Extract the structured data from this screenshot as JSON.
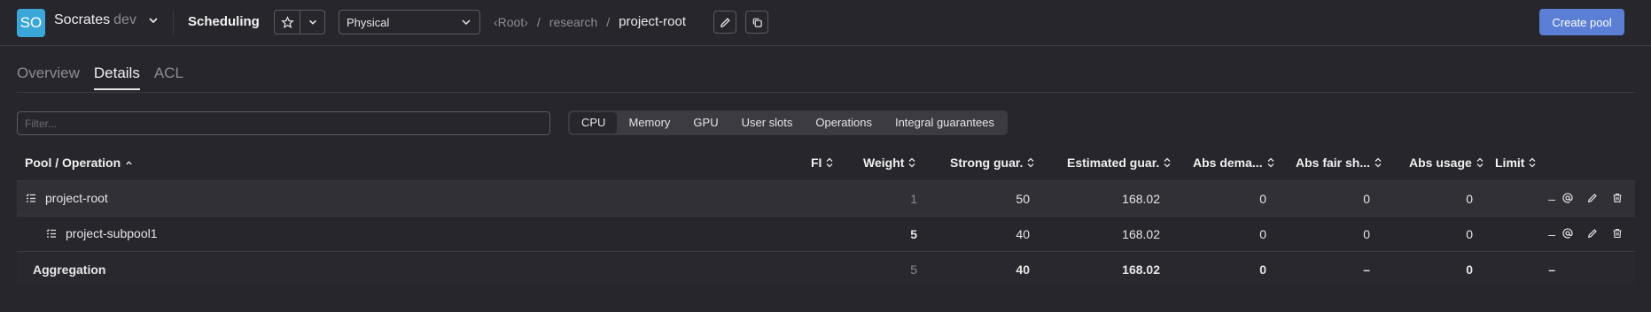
{
  "header": {
    "logo": "SO",
    "cluster_name": "Socrates",
    "cluster_env": "dev",
    "page_title": "Scheduling",
    "tree": "Physical",
    "breadcrumb": [
      "‹Root›",
      "/",
      "research",
      "/",
      "project-root"
    ],
    "create_label": "Create pool"
  },
  "tabs": [
    {
      "label": "Overview",
      "active": false
    },
    {
      "label": "Details",
      "active": true
    },
    {
      "label": "ACL",
      "active": false
    }
  ],
  "toolbar": {
    "filter_placeholder": "Filter...",
    "resources": [
      "CPU",
      "Memory",
      "GPU",
      "User slots",
      "Operations",
      "Integral guarantees"
    ],
    "active_resource": "CPU"
  },
  "table": {
    "columns": [
      "Pool / Operation",
      "FI",
      "Weight",
      "Strong guar.",
      "Estimated guar.",
      "Abs dema...",
      "Abs fair sh...",
      "Abs usage",
      "Limit"
    ],
    "rows": [
      {
        "name": "project-root",
        "weight": "1",
        "strong": "50",
        "estimated": "168.02",
        "abs_demand": "0",
        "abs_fair": "0",
        "abs_usage": "0",
        "limit": "–"
      },
      {
        "name": "project-subpool1",
        "weight": "5",
        "strong": "40",
        "estimated": "168.02",
        "abs_demand": "0",
        "abs_fair": "0",
        "abs_usage": "0",
        "limit": "–"
      }
    ],
    "aggregation": {
      "label": "Aggregation",
      "weight": "5",
      "strong": "40",
      "estimated": "168.02",
      "abs_demand": "0",
      "abs_fair": "–",
      "abs_usage": "0",
      "limit": "–"
    }
  },
  "colors": {
    "accent": "#5b7fd4",
    "logo": "#3aa7d8",
    "background": "#27262c"
  }
}
